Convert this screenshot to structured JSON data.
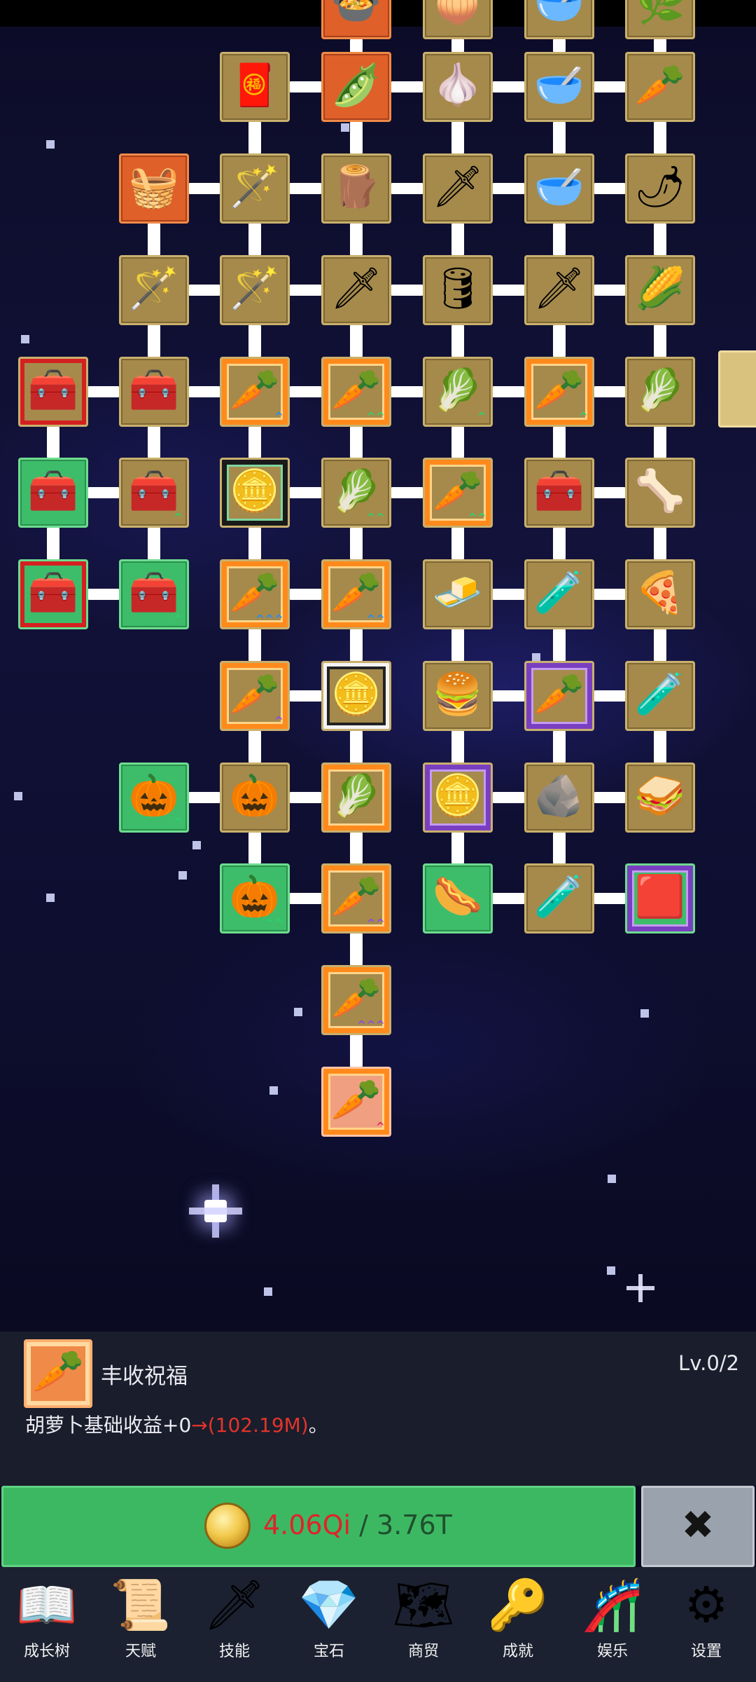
{
  "tree": {
    "nodes": [
      {
        "id": "r0c3",
        "row": 0,
        "col": 3,
        "color": "orange",
        "icon": "🍲",
        "icon_name": "stew-bowl-icon"
      },
      {
        "id": "r0c4",
        "row": 0,
        "col": 4,
        "color": "tan",
        "icon": "🧅",
        "icon_name": "onion-icon"
      },
      {
        "id": "r0c5",
        "row": 0,
        "col": 5,
        "color": "tan",
        "icon": "🥣",
        "icon_name": "bowl-icon"
      },
      {
        "id": "r0c6",
        "row": 0,
        "col": 6,
        "color": "tan",
        "icon": "🌿",
        "icon_name": "leaf-icon"
      },
      {
        "id": "r1c2",
        "row": 1,
        "col": 2,
        "color": "tan",
        "icon": "🧧",
        "icon_name": "crate-carrots-icon"
      },
      {
        "id": "r1c3",
        "row": 1,
        "col": 3,
        "color": "orange",
        "icon": "🫛",
        "icon_name": "pea-pod-icon"
      },
      {
        "id": "r1c4",
        "row": 1,
        "col": 4,
        "color": "tan",
        "icon": "🧄",
        "icon_name": "garlic-icon"
      },
      {
        "id": "r1c5",
        "row": 1,
        "col": 5,
        "color": "tan",
        "icon": "🥣",
        "icon_name": "soup-bowl-icon"
      },
      {
        "id": "r1c6",
        "row": 1,
        "col": 6,
        "color": "tan",
        "icon": "🥕",
        "icon_name": "radish-icon"
      },
      {
        "id": "r2c1",
        "row": 2,
        "col": 1,
        "color": "orange",
        "icon": "🧺",
        "icon_name": "crate-icon"
      },
      {
        "id": "r2c2",
        "row": 2,
        "col": 2,
        "color": "tan",
        "icon": "🪄",
        "icon_name": "blue-wand-icon"
      },
      {
        "id": "r2c3",
        "row": 2,
        "col": 3,
        "color": "tan",
        "icon": "🪵",
        "icon_name": "wood-planks-icon"
      },
      {
        "id": "r2c4",
        "row": 2,
        "col": 4,
        "color": "tan",
        "icon": "🗡",
        "icon_name": "golden-sword-icon"
      },
      {
        "id": "r2c5",
        "row": 2,
        "col": 5,
        "color": "tan",
        "icon": "🥣",
        "icon_name": "wooden-bowl-icon"
      },
      {
        "id": "r2c6",
        "row": 2,
        "col": 6,
        "color": "tan",
        "icon": "🌶",
        "icon_name": "chili-icon"
      },
      {
        "id": "r3c1",
        "row": 3,
        "col": 1,
        "color": "tan",
        "icon": "🪄",
        "icon_name": "red-staff-icon"
      },
      {
        "id": "r3c2",
        "row": 3,
        "col": 2,
        "color": "tan",
        "icon": "🪄",
        "icon_name": "green-wand-icon"
      },
      {
        "id": "r3c3",
        "row": 3,
        "col": 3,
        "color": "tan",
        "icon": "🗡",
        "icon_name": "iron-sword-icon"
      },
      {
        "id": "r3c4",
        "row": 3,
        "col": 4,
        "color": "tan",
        "icon": "🛢",
        "icon_name": "barrel-icon"
      },
      {
        "id": "r3c5",
        "row": 3,
        "col": 5,
        "color": "tan",
        "icon": "🗡",
        "icon_name": "short-sword-icon"
      },
      {
        "id": "r3c6",
        "row": 3,
        "col": 6,
        "color": "tan",
        "icon": "🌽",
        "icon_name": "corn-icon"
      },
      {
        "id": "r4c0",
        "row": 4,
        "col": 0,
        "color": "tan",
        "frame": "red",
        "icon": "🧰",
        "icon_name": "chest-icon"
      },
      {
        "id": "r4c1",
        "row": 4,
        "col": 1,
        "color": "tan",
        "icon": "🧰",
        "icon_name": "chest-icon"
      },
      {
        "id": "r4c2",
        "row": 4,
        "col": 2,
        "color": "tan",
        "frame": "orange",
        "icon": "🥕",
        "icon_name": "carrot-icon",
        "tier": "^",
        "tier_color": "#2a8cf0"
      },
      {
        "id": "r4c3",
        "row": 4,
        "col": 3,
        "color": "tan",
        "frame": "orange",
        "icon": "🥕",
        "icon_name": "carrot-icon",
        "tier": "^^",
        "tier_color": "#2fd06a"
      },
      {
        "id": "r4c4",
        "row": 4,
        "col": 4,
        "color": "tan",
        "icon": "🥬",
        "icon_name": "cabbage-icon",
        "tier": "^",
        "tier_color": "#2fd06a"
      },
      {
        "id": "r4c5",
        "row": 4,
        "col": 5,
        "color": "tan",
        "frame": "orange",
        "icon": "🥕",
        "icon_name": "carrot-icon",
        "tier": "^",
        "tier_color": "#2fd06a"
      },
      {
        "id": "r4c6",
        "row": 4,
        "col": 6,
        "color": "tan",
        "icon": "🥬",
        "icon_name": "cabbage-icon"
      },
      {
        "id": "r5c0",
        "row": 5,
        "col": 0,
        "color": "green",
        "icon": "🧰",
        "icon_name": "gold-chest-icon"
      },
      {
        "id": "r5c1",
        "row": 5,
        "col": 1,
        "color": "tan",
        "icon": "🧰",
        "icon_name": "chest-icon",
        "tier": "^",
        "tier_color": "#2fd06a"
      },
      {
        "id": "r5c2",
        "row": 5,
        "col": 2,
        "color": "tan",
        "frame": "black",
        "icon": "🪙",
        "icon_name": "coin-icon"
      },
      {
        "id": "r5c3",
        "row": 5,
        "col": 3,
        "color": "tan",
        "icon": "🥬",
        "icon_name": "cabbage-icon",
        "tier": "^^",
        "tier_color": "#2fd06a"
      },
      {
        "id": "r5c4",
        "row": 5,
        "col": 4,
        "color": "tan",
        "frame": "orange",
        "icon": "🥕",
        "icon_name": "carrot-icon",
        "tier": "^^",
        "tier_color": "#2fd06a"
      },
      {
        "id": "r5c5",
        "row": 5,
        "col": 5,
        "color": "tan",
        "icon": "🧰",
        "icon_name": "treasure-chest-icon"
      },
      {
        "id": "r5c6",
        "row": 5,
        "col": 6,
        "color": "tan",
        "icon": "🦴",
        "icon_name": "bone-icon"
      },
      {
        "id": "r6c0",
        "row": 6,
        "col": 0,
        "color": "green",
        "frame": "red",
        "icon": "🧰",
        "icon_name": "gold-chest-icon"
      },
      {
        "id": "r6c1",
        "row": 6,
        "col": 1,
        "color": "green",
        "icon": "🧰",
        "icon_name": "gold-chest-icon",
        "tier": "^",
        "tier_color": "#2fd06a"
      },
      {
        "id": "r6c2",
        "row": 6,
        "col": 2,
        "color": "tan",
        "frame": "orange",
        "icon": "🥕",
        "icon_name": "carrot-icon",
        "tier": "^^^",
        "tier_color": "#2a8cf0"
      },
      {
        "id": "r6c3",
        "row": 6,
        "col": 3,
        "color": "tan",
        "frame": "orange",
        "icon": "🥕",
        "icon_name": "carrot-icon",
        "tier": "^^",
        "tier_color": "#2a8cf0"
      },
      {
        "id": "r6c4",
        "row": 6,
        "col": 4,
        "color": "tan",
        "icon": "🧈",
        "icon_name": "gold-bar-icon"
      },
      {
        "id": "r6c5",
        "row": 6,
        "col": 5,
        "color": "tan",
        "icon": "🧪",
        "icon_name": "yellow-potion-icon"
      },
      {
        "id": "r6c6",
        "row": 6,
        "col": 6,
        "color": "tan",
        "icon": "🍕",
        "icon_name": "pizza-icon"
      },
      {
        "id": "r7c2",
        "row": 7,
        "col": 2,
        "color": "tan",
        "frame": "orange",
        "icon": "🥕",
        "icon_name": "carrot-icon",
        "tier": "^",
        "tier_color": "#8a4fe0"
      },
      {
        "id": "r7c3",
        "row": 7,
        "col": 3,
        "color": "tan",
        "frame": "white",
        "icon": "🪙",
        "icon_name": "coin-icon"
      },
      {
        "id": "r7c4",
        "row": 7,
        "col": 4,
        "color": "tan",
        "icon": "🍔",
        "icon_name": "burger-icon"
      },
      {
        "id": "r7c5",
        "row": 7,
        "col": 5,
        "color": "tan",
        "frame": "purple",
        "icon": "🥕",
        "icon_name": "carrot-card-icon"
      },
      {
        "id": "r7c6",
        "row": 7,
        "col": 6,
        "color": "tan",
        "icon": "🧪",
        "icon_name": "yellow-flask-icon"
      },
      {
        "id": "r8c1",
        "row": 8,
        "col": 1,
        "color": "green",
        "icon": "🎃",
        "icon_name": "pumpkin-icon",
        "tier": "^",
        "tier_color": "#2fd06a"
      },
      {
        "id": "r8c2",
        "row": 8,
        "col": 2,
        "color": "tan",
        "icon": "🎃",
        "icon_name": "pumpkin-icon"
      },
      {
        "id": "r8c3",
        "row": 8,
        "col": 3,
        "color": "tan",
        "frame": "orange",
        "icon": "🥬",
        "icon_name": "cabbage-icon"
      },
      {
        "id": "r8c4",
        "row": 8,
        "col": 4,
        "color": "tan",
        "frame": "purple",
        "icon": "🪙",
        "icon_name": "coin-card-icon"
      },
      {
        "id": "r8c5",
        "row": 8,
        "col": 5,
        "color": "tan",
        "icon": "🪨",
        "icon_name": "rock-icon"
      },
      {
        "id": "r8c6",
        "row": 8,
        "col": 6,
        "color": "tan",
        "icon": "🥪",
        "icon_name": "sandwich-icon"
      },
      {
        "id": "r9c2",
        "row": 9,
        "col": 2,
        "color": "green",
        "icon": "🎃",
        "icon_name": "pumpkin-icon",
        "tier": "^^",
        "tier_color": "#2fd06a"
      },
      {
        "id": "r9c3",
        "row": 9,
        "col": 3,
        "color": "tan",
        "frame": "orange",
        "icon": "🥕",
        "icon_name": "carrot-icon",
        "tier": "^^",
        "tier_color": "#8a4fe0"
      },
      {
        "id": "r9c4",
        "row": 9,
        "col": 4,
        "color": "green",
        "icon": "🌭",
        "icon_name": "hotdog-icon"
      },
      {
        "id": "r9c5",
        "row": 9,
        "col": 5,
        "color": "tan",
        "icon": "🧪",
        "icon_name": "red-potion-icon"
      },
      {
        "id": "r9c6",
        "row": 9,
        "col": 6,
        "color": "green",
        "frame": "purple",
        "icon": "🟥",
        "icon_name": "red-card-icon"
      },
      {
        "id": "r10c3",
        "row": 10,
        "col": 3,
        "color": "tan",
        "frame": "orange",
        "icon": "🥕",
        "icon_name": "carrot-icon",
        "tier": "^^^",
        "tier_color": "#8a4fe0"
      },
      {
        "id": "r11c3",
        "row": 11,
        "col": 3,
        "color": "salmon",
        "frame": "orange",
        "icon": "🥕",
        "icon_name": "carrot-icon",
        "tier": "^",
        "tier_color": "#e0306a"
      }
    ],
    "links": [
      [
        "r1c2",
        "r1c3"
      ],
      [
        "r1c3",
        "r1c4"
      ],
      [
        "r1c4",
        "r1c5"
      ],
      [
        "r1c5",
        "r1c6"
      ],
      [
        "r0c3",
        "r1c3"
      ],
      [
        "r0c4",
        "r1c4"
      ],
      [
        "r0c5",
        "r1c5"
      ],
      [
        "r0c6",
        "r1c6"
      ],
      [
        "r2c1",
        "r2c2"
      ],
      [
        "r2c2",
        "r2c3"
      ],
      [
        "r2c3",
        "r2c4"
      ],
      [
        "r2c4",
        "r2c5"
      ],
      [
        "r2c5",
        "r2c6"
      ],
      [
        "r1c2",
        "r2c2"
      ],
      [
        "r1c3",
        "r2c3"
      ],
      [
        "r1c4",
        "r2c4"
      ],
      [
        "r1c5",
        "r2c5"
      ],
      [
        "r1c6",
        "r2c6"
      ],
      [
        "r3c1",
        "r3c2"
      ],
      [
        "r3c2",
        "r3c3"
      ],
      [
        "r3c3",
        "r3c4"
      ],
      [
        "r3c4",
        "r3c5"
      ],
      [
        "r3c5",
        "r3c6"
      ],
      [
        "r2c1",
        "r3c1"
      ],
      [
        "r2c2",
        "r3c2"
      ],
      [
        "r2c3",
        "r3c3"
      ],
      [
        "r2c4",
        "r3c4"
      ],
      [
        "r2c5",
        "r3c5"
      ],
      [
        "r2c6",
        "r3c6"
      ],
      [
        "r4c0",
        "r4c1"
      ],
      [
        "r4c1",
        "r4c2"
      ],
      [
        "r4c2",
        "r4c3"
      ],
      [
        "r4c3",
        "r4c4"
      ],
      [
        "r4c4",
        "r4c5"
      ],
      [
        "r4c5",
        "r4c6"
      ],
      [
        "r3c1",
        "r4c1"
      ],
      [
        "r3c2",
        "r4c2"
      ],
      [
        "r3c3",
        "r4c3"
      ],
      [
        "r3c4",
        "r4c4"
      ],
      [
        "r3c5",
        "r4c5"
      ],
      [
        "r3c6",
        "r4c6"
      ],
      [
        "r5c0",
        "r5c1"
      ],
      [
        "r5c2",
        "r5c3"
      ],
      [
        "r5c3",
        "r5c4"
      ],
      [
        "r5c5",
        "r5c6"
      ],
      [
        "r4c0",
        "r5c0"
      ],
      [
        "r4c1",
        "r5c1"
      ],
      [
        "r4c2",
        "r5c2"
      ],
      [
        "r4c3",
        "r5c3"
      ],
      [
        "r4c4",
        "r5c4"
      ],
      [
        "r4c5",
        "r5c5"
      ],
      [
        "r4c6",
        "r5c6"
      ],
      [
        "r6c0",
        "r6c1"
      ],
      [
        "r6c2",
        "r6c3"
      ],
      [
        "r6c4",
        "r6c5"
      ],
      [
        "r6c5",
        "r6c6"
      ],
      [
        "r5c0",
        "r6c0"
      ],
      [
        "r5c1",
        "r6c1"
      ],
      [
        "r5c2",
        "r6c2"
      ],
      [
        "r5c3",
        "r6c3"
      ],
      [
        "r5c4",
        "r6c4"
      ],
      [
        "r5c5",
        "r6c5"
      ],
      [
        "r5c6",
        "r6c6"
      ],
      [
        "r7c2",
        "r7c3"
      ],
      [
        "r7c4",
        "r7c5"
      ],
      [
        "r7c5",
        "r7c6"
      ],
      [
        "r6c2",
        "r7c2"
      ],
      [
        "r6c3",
        "r7c3"
      ],
      [
        "r6c4",
        "r7c4"
      ],
      [
        "r6c5",
        "r7c5"
      ],
      [
        "r6c6",
        "r7c6"
      ],
      [
        "r8c1",
        "r8c2"
      ],
      [
        "r8c2",
        "r8c3"
      ],
      [
        "r8c4",
        "r8c5"
      ],
      [
        "r8c5",
        "r8c6"
      ],
      [
        "r7c2",
        "r8c2"
      ],
      [
        "r7c3",
        "r8c3"
      ],
      [
        "r7c4",
        "r8c4"
      ],
      [
        "r7c5",
        "r8c5"
      ],
      [
        "r7c6",
        "r8c6"
      ],
      [
        "r9c2",
        "r9c3"
      ],
      [
        "r9c4",
        "r9c5"
      ],
      [
        "r9c5",
        "r9c6"
      ],
      [
        "r8c2",
        "r9c2"
      ],
      [
        "r8c3",
        "r9c3"
      ],
      [
        "r8c4",
        "r9c4"
      ],
      [
        "r8c5",
        "r9c5"
      ],
      [
        "r9c3",
        "r10c3"
      ],
      [
        "r10c3",
        "r11c3"
      ]
    ]
  },
  "info": {
    "skill_name": "丰收祝福",
    "level": "Lv.0/2",
    "desc_prefix": "胡萝卜基础收益+0",
    "desc_arrow": "→",
    "desc_new": "(102.19M)",
    "desc_suffix": "。",
    "icon": "🥕"
  },
  "cost": {
    "have": "4.06Qi",
    "separator": " / ",
    "need": "3.76T"
  },
  "close": {
    "symbol": "✖"
  },
  "nav": [
    {
      "key": "growth",
      "label": "成长树",
      "icon": "📖",
      "icon_name": "book-icon"
    },
    {
      "key": "talent",
      "label": "天赋",
      "icon": "📜",
      "icon_name": "scroll-icon"
    },
    {
      "key": "skill",
      "label": "技能",
      "icon": "🗡",
      "icon_name": "sword-icon"
    },
    {
      "key": "gem",
      "label": "宝石",
      "icon": "💎",
      "icon_name": "crystal-icon"
    },
    {
      "key": "trade",
      "label": "商贸",
      "icon": "🗺",
      "icon_name": "map-icon"
    },
    {
      "key": "achieve",
      "label": "成就",
      "icon": "🔑",
      "icon_name": "key-icon"
    },
    {
      "key": "fun",
      "label": "娱乐",
      "icon": "🎢",
      "icon_name": "slide-icon"
    },
    {
      "key": "settings",
      "label": "设置",
      "icon": "⚙",
      "icon_name": "gear-icon"
    }
  ],
  "colors": {
    "tan": "#a58a4c",
    "orange": "#e0602a",
    "green": "#3dbd6a",
    "pale": "#d9c27e",
    "salmon": "#f0a080",
    "cost_have": "#e0232a",
    "button_green": "#3db862"
  }
}
